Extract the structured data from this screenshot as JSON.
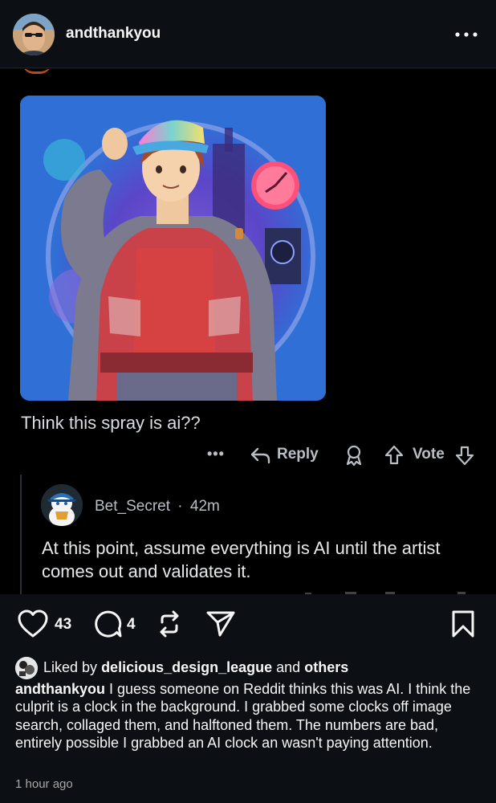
{
  "header": {
    "username": "andthankyou",
    "more_icon": "more-horizontal-icon"
  },
  "screenshot": {
    "post_caption": "Think this spray is ai??",
    "actions": {
      "more": "•••",
      "reply_label": "Reply",
      "vote_label": "Vote"
    },
    "comment": {
      "user": "Bet_Secret",
      "separator": "·",
      "age": "42m",
      "text": "At this point, assume everything is AI until the artist comes out and validates it."
    },
    "image_palette": {
      "background": "#2f6fd6",
      "jacket": "#c9424a",
      "sleeves": "#7c7a8f",
      "shirt": "#d64242",
      "hair": "#a24a2c",
      "cap": "#7ad3d0",
      "clock": "#ff4f7b"
    }
  },
  "instagram": {
    "like_count": "43",
    "comment_count": "4",
    "likes": {
      "prefix": "Liked by",
      "user": "delicious_design_league",
      "middle": "and",
      "others": "others"
    },
    "caption_user": "andthankyou",
    "caption_text": "I guess someone on Reddit thinks this was AI. I think the culprit is a clock in the background. I grabbed some clocks off image search, collaged them, and halftoned them. The numbers are bad, entirely possible I grabbed an AI clock an wasn't paying attention.",
    "time": "1 hour ago"
  },
  "colors": {
    "app_background": "#0c1014",
    "reddit_background": "#000000",
    "text_primary": "#f5f5f5",
    "text_muted": "#b9bec4"
  }
}
